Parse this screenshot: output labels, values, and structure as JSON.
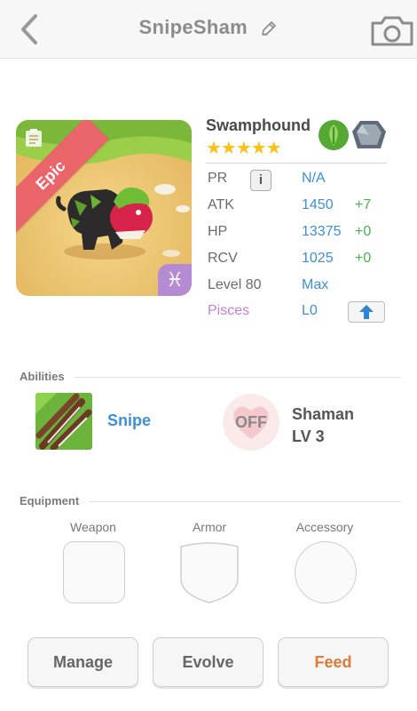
{
  "header": {
    "title": "SnipeSham"
  },
  "monster": {
    "rarity": "Epic",
    "zodiac_symbol": "♓",
    "name": "Swamphound",
    "stars": "★★★★★",
    "star_count": 5,
    "elements": [
      "leaf",
      "stone"
    ]
  },
  "stats": {
    "pr": {
      "label": "PR",
      "info": "i",
      "value": "N/A"
    },
    "atk": {
      "label": "ATK",
      "value": "1450",
      "bonus": "+7"
    },
    "hp": {
      "label": "HP",
      "value": "13375",
      "bonus": "+0"
    },
    "rcv": {
      "label": "RCV",
      "value": "1025",
      "bonus": "+0"
    },
    "level": {
      "label": "Level 80",
      "value": "Max"
    },
    "sign": {
      "label": "Pisces",
      "value": "L0"
    }
  },
  "abilities": {
    "section_title": "Abilities",
    "primary": {
      "name": "Snipe"
    },
    "secondary": {
      "status": "OFF",
      "name_line1": "Shaman",
      "name_line2": "LV 3"
    }
  },
  "equipment": {
    "section_title": "Equipment",
    "weapon": "Weapon",
    "armor": "Armor",
    "accessory": "Accessory"
  },
  "actions": {
    "manage": "Manage",
    "evolve": "Evolve",
    "feed": "Feed"
  },
  "colors": {
    "epic_ribbon": "#e96569",
    "link_blue": "#3e8fd6",
    "bonus_green": "#4caf50",
    "pisces_pink": "#c77fcc",
    "feed_orange": "#e27a35",
    "star_gold": "#f9c21a"
  }
}
